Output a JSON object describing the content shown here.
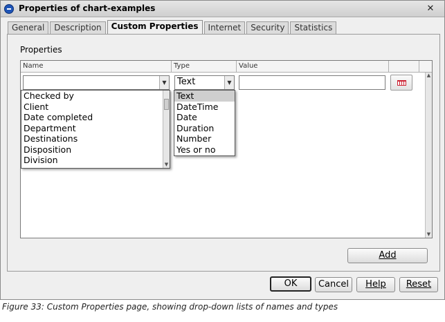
{
  "window": {
    "title": "Properties of chart-examples",
    "close_glyph": "✕"
  },
  "tabs": [
    {
      "label": "General",
      "active": false
    },
    {
      "label": "Description",
      "active": false
    },
    {
      "label": "Custom Properties",
      "active": true
    },
    {
      "label": "Internet",
      "active": false
    },
    {
      "label": "Security",
      "active": false
    },
    {
      "label": "Statistics",
      "active": false
    }
  ],
  "panel": {
    "section_label": "Properties",
    "columns": [
      "Name",
      "Type",
      "Value"
    ],
    "row": {
      "name_value": "",
      "type_value": "Text",
      "value_value": ""
    }
  },
  "name_dropdown": {
    "items": [
      "Checked by",
      "Client",
      "Date completed",
      "Department",
      "Destinations",
      "Disposition",
      "Division"
    ]
  },
  "type_dropdown": {
    "items": [
      "Text",
      "DateTime",
      "Date",
      "Duration",
      "Number",
      "Yes or no"
    ],
    "selected": "Text"
  },
  "buttons": {
    "add": "Add",
    "ok": "OK",
    "cancel": "Cancel",
    "help": "Help",
    "reset": "Reset"
  },
  "icons": {
    "calendar": "calendar-icon",
    "dropdown": "chevron-down-icon"
  },
  "caption": "Figure 33: Custom Properties page, showing drop-down lists of names and types"
}
